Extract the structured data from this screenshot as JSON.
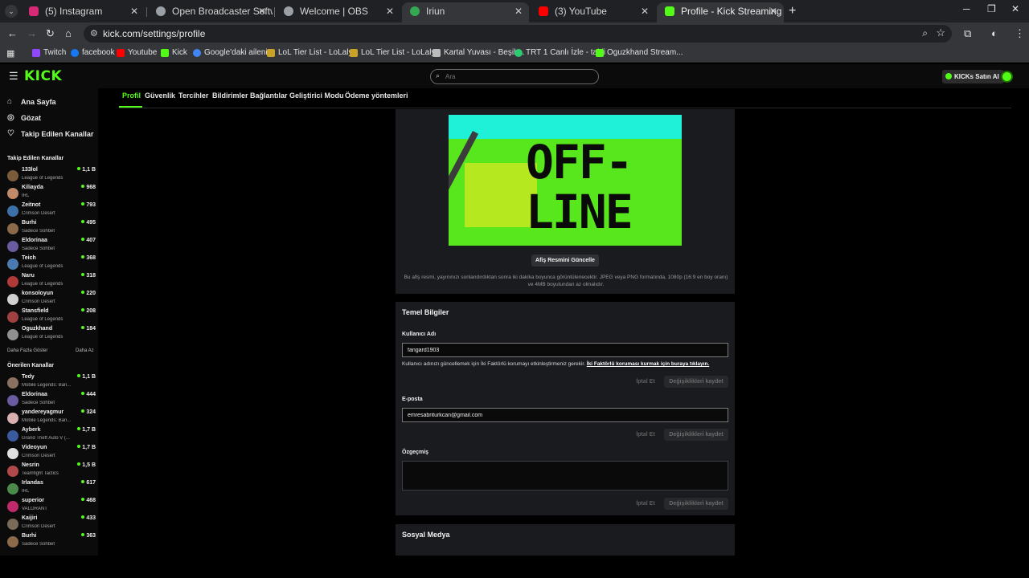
{
  "browser": {
    "tabs": [
      {
        "title": "(5) Instagram",
        "color": "#d62976"
      },
      {
        "title": "Open Broadcaster Software | OB",
        "color": "#9aa0a6"
      },
      {
        "title": "Welcome | OBS",
        "color": "#9aa0a6"
      },
      {
        "title": "Iriun",
        "color": "#34a853"
      },
      {
        "title": "(3) YouTube",
        "color": "#ff0000"
      },
      {
        "title": "Profile - Kick Streaming",
        "color": "#53fc18"
      }
    ],
    "close_glyph": "✕",
    "new_tab_glyph": "+",
    "url": "kick.com/settings/profile",
    "bookmarks": [
      {
        "label": "Twitch",
        "color": "#9146ff"
      },
      {
        "label": "facebook",
        "color": "#1877f2"
      },
      {
        "label": "Youtube",
        "color": "#ff0000"
      },
      {
        "label": "Kick",
        "color": "#53fc18"
      },
      {
        "label": "Google'daki aileniz",
        "color": "#4285f4"
      },
      {
        "label": "LoL Tier List - LoLaly...",
        "color": "#c9a227"
      },
      {
        "label": "LoL Tier List - LoLaly...",
        "color": "#c9a227"
      },
      {
        "label": "Kartal Yuvası - Beşik...",
        "color": "#bbbbbb"
      },
      {
        "label": "TRT 1 Canlı İzle - tabii",
        "color": "#2ecc71"
      },
      {
        "label": "Oguzkhand Stream...",
        "color": "#53fc18"
      }
    ]
  },
  "header": {
    "logo": "KICK",
    "search_placeholder": "Ara",
    "buy_kicks": "KICKs Satın Al"
  },
  "settings_tabs": [
    "Profil",
    "Güvenlik",
    "Tercihler",
    "Bildirimler",
    "Bağlantılar",
    "Geliştirici Modu",
    "Ödeme yöntemleri"
  ],
  "sidebar": {
    "nav": [
      {
        "label": "Ana Sayfa",
        "icon": "home-icon"
      },
      {
        "label": "Gözat",
        "icon": "compass-icon"
      },
      {
        "label": "Takip Edilen Kanallar",
        "icon": "heart-icon"
      }
    ],
    "followed_title": "Takip Edilen Kanallar",
    "followed": [
      {
        "name": "133lol",
        "category": "League of Legends",
        "viewers": "1,1 B",
        "color": "#7a5c3c"
      },
      {
        "name": "Kiliayda",
        "category": "IRL",
        "viewers": "968",
        "color": "#c08a6a"
      },
      {
        "name": "Zeitnot",
        "category": "Crimson Desert",
        "viewers": "793",
        "color": "#3d6fa8"
      },
      {
        "name": "Burhi",
        "category": "Sadece Sohbet",
        "viewers": "495",
        "color": "#8a6a4a"
      },
      {
        "name": "Eldorinaa",
        "category": "Sadece Sohbet",
        "viewers": "407",
        "color": "#6a5aa0"
      },
      {
        "name": "Teich",
        "category": "League of Legends",
        "viewers": "368",
        "color": "#4a7ab0"
      },
      {
        "name": "Naru",
        "category": "League of Legends",
        "viewers": "318",
        "color": "#b03a3a"
      },
      {
        "name": "konsoloyun",
        "category": "Crimson Desert",
        "viewers": "220",
        "color": "#d0d0d0"
      },
      {
        "name": "Stansfield",
        "category": "League of Legends",
        "viewers": "208",
        "color": "#a04040"
      },
      {
        "name": "Oguzkhand",
        "category": "League of Legends",
        "viewers": "184",
        "color": "#909090"
      }
    ],
    "show_more": "Daha Fazla Göster",
    "show_less": "Daha Az",
    "recommended_title": "Önerilen Kanallar",
    "recommended": [
      {
        "name": "Tedy",
        "category": "Mobile Legends: Ban...",
        "viewers": "1,1 B",
        "color": "#8a7060"
      },
      {
        "name": "Eldorinaa",
        "category": "Sadece Sohbet",
        "viewers": "444",
        "color": "#6a5aa0"
      },
      {
        "name": "yandereyagmur",
        "category": "Mobile Legends: Ban...",
        "viewers": "324",
        "color": "#d8b0b0"
      },
      {
        "name": "Ayberk",
        "category": "Grand Theft Auto V (...",
        "viewers": "1,7 B",
        "color": "#3a5aa0"
      },
      {
        "name": "Videoyun",
        "category": "Crimson Desert",
        "viewers": "1,7 B",
        "color": "#e0e0e0"
      },
      {
        "name": "Nesrin",
        "category": "Teamfight Tactics",
        "viewers": "1,5 B",
        "color": "#b04a4a"
      },
      {
        "name": "Irlandas",
        "category": "IRL",
        "viewers": "617",
        "color": "#4a8a4a"
      },
      {
        "name": "superior",
        "category": "VALORANT",
        "viewers": "468",
        "color": "#c02a6a"
      },
      {
        "name": "Kaijiri",
        "category": "Crimson Desert",
        "viewers": "433",
        "color": "#7a6a5a"
      },
      {
        "name": "Burhi",
        "category": "Sadece Sohbet",
        "viewers": "363",
        "color": "#8a6a4a"
      }
    ]
  },
  "banner": {
    "offline_line1": "OFF-",
    "offline_line2": "LINE",
    "update_button": "Afiş Resmini Güncelle",
    "note": "Bu afiş resmi, yayınınızı sonlandırdıktan sonra iki dakika boyunca görüntülenecektir. JPEG veya PNG formatında, 1080p (16:9 en boy oranı) ve 4MB boyutundan az olmalıdır."
  },
  "basic_info": {
    "title": "Temel Bilgiler",
    "username_label": "Kullanıcı Adı",
    "username_value": "fangard1903",
    "username_hint": "Kullanıcı adınızı güncellemek için İki Faktörlü korumayı etkinleştirmeniz gerekir.",
    "username_hint_link": "İki Faktörlü koruması kurmak için buraya tıklayın.",
    "cancel": "İptal Et",
    "save": "Değişiklikleri kaydet",
    "email_label": "E-posta",
    "email_value": "emresabriturkcan@gmail.com",
    "bio_label": "Özgeçmiş",
    "bio_value": ""
  },
  "social": {
    "title": "Sosyal Medya"
  }
}
